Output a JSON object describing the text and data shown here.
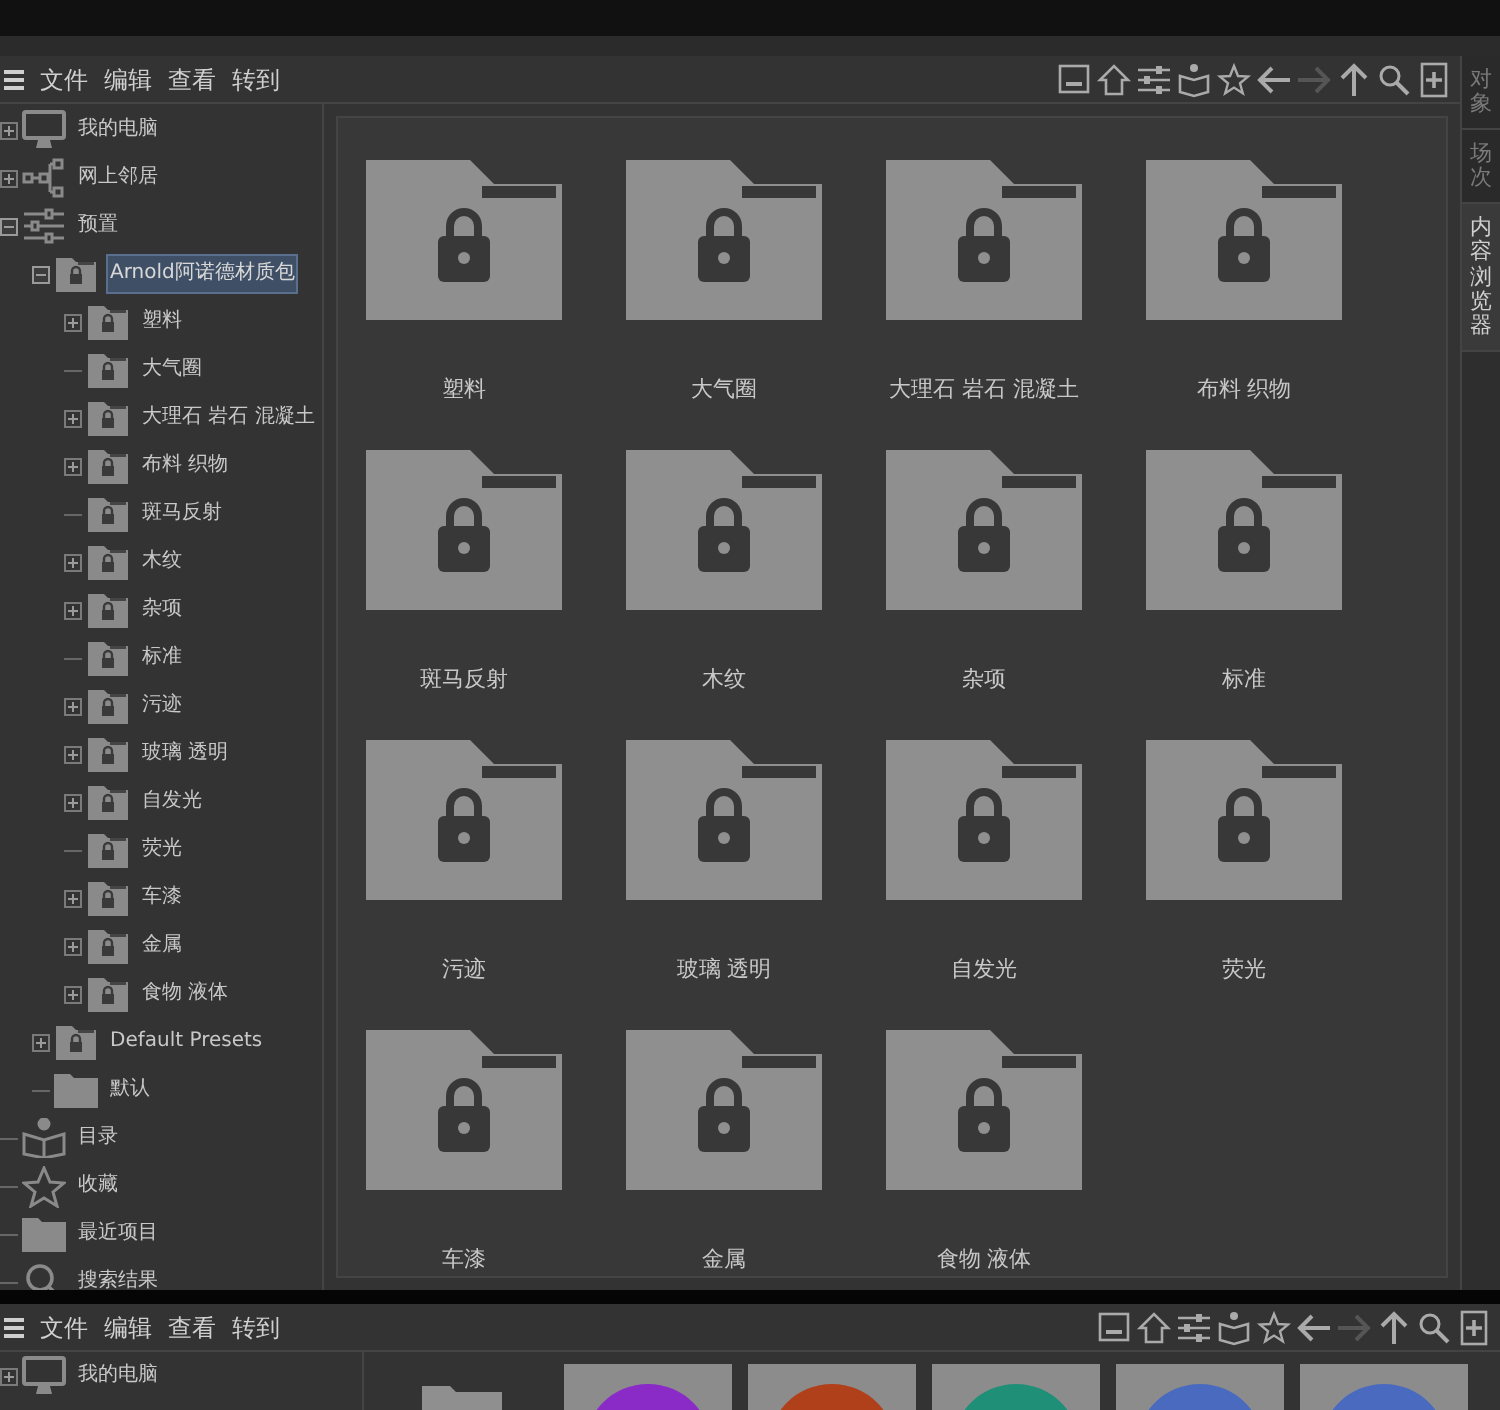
{
  "menu": [
    "文件",
    "编辑",
    "查看",
    "转到"
  ],
  "side_tabs": [
    {
      "label": "对象",
      "selected": false
    },
    {
      "label": "场次",
      "selected": false
    },
    {
      "label": "内容浏览器",
      "selected": true
    }
  ],
  "tree": [
    {
      "label": "我的电脑",
      "kind": "computer",
      "expanded": false,
      "selected": false
    },
    {
      "label": "网上邻居",
      "kind": "network",
      "expanded": false,
      "selected": false
    },
    {
      "label": "预置",
      "kind": "sliders",
      "expanded": true,
      "selected": false,
      "children": [
        {
          "label": "Arnold阿诺德材质包",
          "kind": "locked-folder",
          "expanded": true,
          "selected": true,
          "children": [
            {
              "label": "塑料",
              "kind": "locked-folder",
              "expanded": false,
              "selected": false
            },
            {
              "label": "大气圈",
              "kind": "locked-folder",
              "selected": false
            },
            {
              "label": "大理石 岩石 混凝土",
              "kind": "locked-folder",
              "expanded": false,
              "selected": false
            },
            {
              "label": "布料 织物",
              "kind": "locked-folder",
              "expanded": false,
              "selected": false
            },
            {
              "label": "斑马反射",
              "kind": "locked-folder",
              "selected": false
            },
            {
              "label": "木纹",
              "kind": "locked-folder",
              "expanded": false,
              "selected": false
            },
            {
              "label": "杂项",
              "kind": "locked-folder",
              "expanded": false,
              "selected": false
            },
            {
              "label": "标准",
              "kind": "locked-folder",
              "selected": false
            },
            {
              "label": "污迹",
              "kind": "locked-folder",
              "expanded": false,
              "selected": false
            },
            {
              "label": "玻璃 透明",
              "kind": "locked-folder",
              "expanded": false,
              "selected": false
            },
            {
              "label": "自发光",
              "kind": "locked-folder",
              "expanded": false,
              "selected": false
            },
            {
              "label": "荧光",
              "kind": "locked-folder",
              "selected": false
            },
            {
              "label": "车漆",
              "kind": "locked-folder",
              "expanded": false,
              "selected": false
            },
            {
              "label": "金属",
              "kind": "locked-folder",
              "expanded": false,
              "selected": false
            },
            {
              "label": "食物 液体",
              "kind": "locked-folder",
              "expanded": false,
              "selected": false
            }
          ]
        },
        {
          "label": "Default Presets",
          "kind": "locked-folder",
          "expanded": false,
          "selected": false
        },
        {
          "label": "默认",
          "kind": "folder",
          "selected": false
        }
      ]
    },
    {
      "label": "目录",
      "kind": "catalog",
      "selected": false
    },
    {
      "label": "收藏",
      "kind": "star",
      "selected": false
    },
    {
      "label": "最近项目",
      "kind": "folder",
      "selected": false
    },
    {
      "label": "搜索结果",
      "kind": "search",
      "selected": false
    }
  ],
  "items": [
    "塑料",
    "大气圈",
    "大理石 岩石 混凝土",
    "布料 织物",
    "斑马反射",
    "木纹",
    "杂项",
    "标准",
    "污迹",
    "玻璃 透明",
    "自发光",
    "荧光",
    "车漆",
    "金属",
    "食物 液体"
  ],
  "second_window": {
    "menu": [
      "文件",
      "编辑",
      "查看",
      "转到"
    ],
    "tree": [
      {
        "label": "我的电脑",
        "kind": "computer",
        "expanded": false,
        "selected": false
      }
    ],
    "thumbnails": [
      {
        "kind": "folder"
      },
      {
        "kind": "material",
        "color": "#8a2bc8"
      },
      {
        "kind": "material",
        "color": "#b0401a"
      },
      {
        "kind": "material",
        "color": "#1f8f78"
      },
      {
        "kind": "material",
        "color": "#4a6ac0"
      },
      {
        "kind": "material",
        "color": "#4a6ac0"
      }
    ]
  }
}
